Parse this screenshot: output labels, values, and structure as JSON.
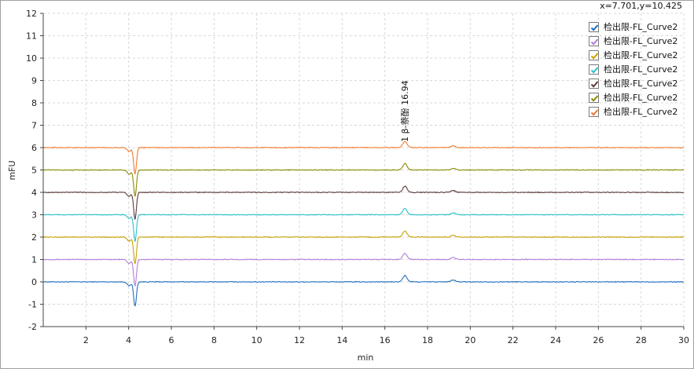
{
  "readout": "x=7.701,y=10.425",
  "chart_data": {
    "type": "line",
    "xlabel": "min",
    "ylabel": "mFU",
    "xlim": [
      0,
      30
    ],
    "ylim": [
      -2,
      12
    ],
    "x_ticks": [
      2,
      4,
      6,
      8,
      10,
      12,
      14,
      16,
      18,
      20,
      22,
      24,
      26,
      28,
      30
    ],
    "y_ticks": [
      -2,
      -1,
      0,
      1,
      2,
      3,
      4,
      5,
      6,
      7,
      8,
      9,
      10,
      11,
      12
    ],
    "grid": true,
    "legend_position": "top-right",
    "series": [
      {
        "name": "检出限-FL_Curve2",
        "color": "#1f6fbf",
        "offset": 0,
        "dip": -1.1
      },
      {
        "name": "检出限-FL_Curve2",
        "color": "#b07fd8",
        "offset": 1,
        "dip": -0.2
      },
      {
        "name": "检出限-FL_Curve2",
        "color": "#c8a000",
        "offset": 2,
        "dip": 0.8
      },
      {
        "name": "检出限-FL_Curve2",
        "color": "#2cc0c8",
        "offset": 3,
        "dip": 1.8
      },
      {
        "name": "检出限-FL_Curve2",
        "color": "#5a3a3a",
        "offset": 4,
        "dip": 2.8
      },
      {
        "name": "检出限-FL_Curve2",
        "color": "#8a8a00",
        "offset": 5,
        "dip": 3.8
      },
      {
        "name": "检出限-FL_Curve2",
        "color": "#f07a30",
        "offset": 6,
        "dip": 4.8
      }
    ],
    "features": {
      "dip_time": 4.3,
      "peak_time": 16.94,
      "peak_height": 0.28,
      "minor_peak_time": 19.2,
      "minor_peak_height": 0.08
    },
    "annotation": {
      "text": "1  β-萘酚 16.94",
      "x": 16.94,
      "y": 6.25
    }
  }
}
